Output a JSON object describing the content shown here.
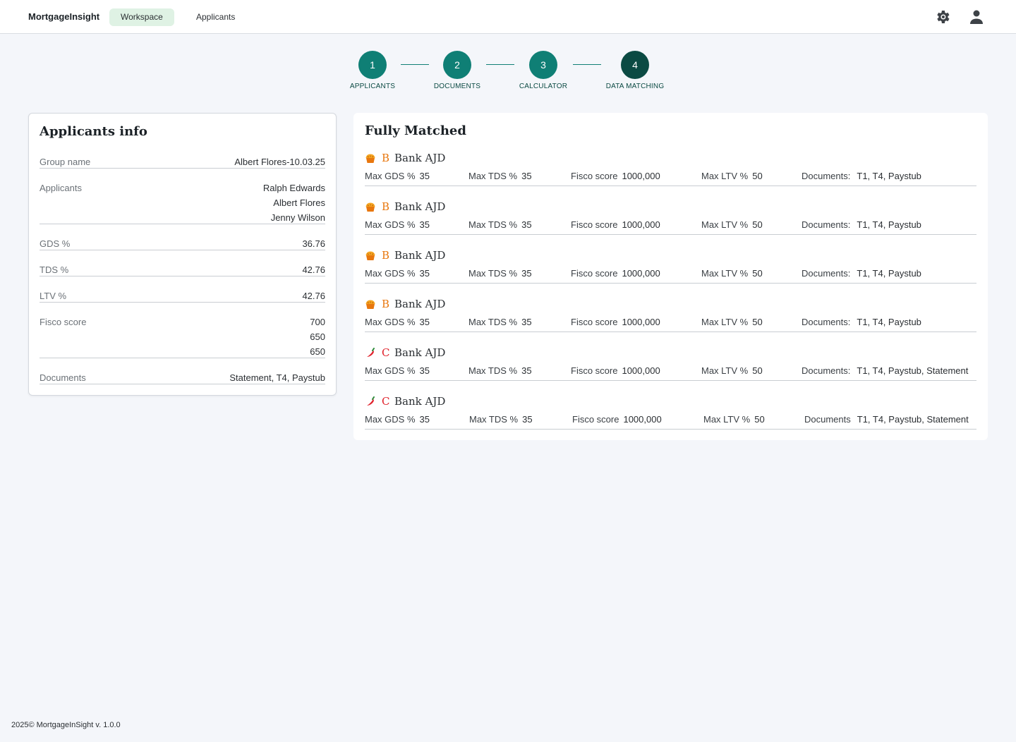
{
  "app": {
    "brand": "MortgageInsight"
  },
  "nav": {
    "workspace": "Workspace",
    "applicants": "Applicants"
  },
  "icons": {
    "settings": "gear-icon",
    "profile": "user-icon"
  },
  "colors": {
    "accent": "#0f7f75",
    "accent_dark": "#0b4a43",
    "tab_active_bg": "#dff2e4",
    "grade_b": "#e8770e",
    "grade_c": "#e0212b"
  },
  "stepper": [
    {
      "num": "1",
      "label": "APPLICANTS"
    },
    {
      "num": "2",
      "label": "DOCUMENTS"
    },
    {
      "num": "3",
      "label": "CALCULATOR"
    },
    {
      "num": "4",
      "label": "DATA MATCHING"
    }
  ],
  "applicants_info": {
    "title": "Applicants info",
    "group_name": {
      "label": "Group name",
      "value": "Albert Flores-10.03.25"
    },
    "applicants": {
      "label": "Applicants",
      "values": [
        "Ralph Edwards",
        "Albert Flores",
        "Jenny Wilson"
      ]
    },
    "gds": {
      "label": "GDS %",
      "value": "36.76"
    },
    "tds": {
      "label": "TDS %",
      "value": "42.76"
    },
    "ltv": {
      "label": "LTV %",
      "value": "42.76"
    },
    "fisco": {
      "label": "Fisco score",
      "values": [
        "700",
        "650",
        "650"
      ]
    },
    "documents": {
      "label": "Documents",
      "value": "Statement, T4, Paystub"
    }
  },
  "matched": {
    "title": "Fully Matched",
    "banks": [
      {
        "grade": "B",
        "icon": "pie-icon",
        "name": "Bank AJD",
        "gds_label": "Max GDS %",
        "gds": "35",
        "tds_label": "Max TDS %",
        "tds": "35",
        "fisco_label": "Fisco score",
        "fisco": "1000,000",
        "ltv_label": "Max LTV %",
        "ltv": "50",
        "docs_label": "Documents:",
        "docs": "T1, T4, Paystub"
      },
      {
        "grade": "B",
        "icon": "pie-icon",
        "name": "Bank AJD",
        "gds_label": "Max GDS %",
        "gds": "35",
        "tds_label": "Max TDS %",
        "tds": "35",
        "fisco_label": "Fisco score",
        "fisco": "1000,000",
        "ltv_label": "Max LTV %",
        "ltv": "50",
        "docs_label": "Documents:",
        "docs": "T1, T4, Paystub"
      },
      {
        "grade": "B",
        "icon": "pie-icon",
        "name": "Bank AJD",
        "gds_label": "Max GDS %",
        "gds": "35",
        "tds_label": "Max TDS %",
        "tds": "35",
        "fisco_label": "Fisco score",
        "fisco": "1000,000",
        "ltv_label": "Max LTV %",
        "ltv": "50",
        "docs_label": "Documents:",
        "docs": "T1, T4, Paystub"
      },
      {
        "grade": "B",
        "icon": "pie-icon",
        "name": "Bank AJD",
        "gds_label": "Max GDS %",
        "gds": "35",
        "tds_label": "Max TDS %",
        "tds": "35",
        "fisco_label": "Fisco score",
        "fisco": "1000,000",
        "ltv_label": "Max LTV %",
        "ltv": "50",
        "docs_label": "Documents:",
        "docs": "T1, T4, Paystub"
      },
      {
        "grade": "C",
        "icon": "chili-icon",
        "name": "Bank AJD",
        "gds_label": "Max GDS %",
        "gds": "35",
        "tds_label": "Max TDS %",
        "tds": "35",
        "fisco_label": "Fisco score",
        "fisco": "1000,000",
        "ltv_label": "Max LTV %",
        "ltv": "50",
        "docs_label": "Documents:",
        "docs": "T1, T4, Paystub, Statement"
      },
      {
        "grade": "C",
        "icon": "chili-icon",
        "name": "Bank AJD",
        "gds_label": "Max GDS %",
        "gds": "35",
        "tds_label": "Max TDS %",
        "tds": "35",
        "fisco_label": "Fisco score",
        "fisco": "1000,000",
        "ltv_label": "Max LTV %",
        "ltv": "50",
        "docs_label": "Documents",
        "docs": "T1, T4, Paystub, Statement"
      }
    ]
  },
  "footer": {
    "text": "2025©  MortgageInSight v. 1.0.0"
  }
}
